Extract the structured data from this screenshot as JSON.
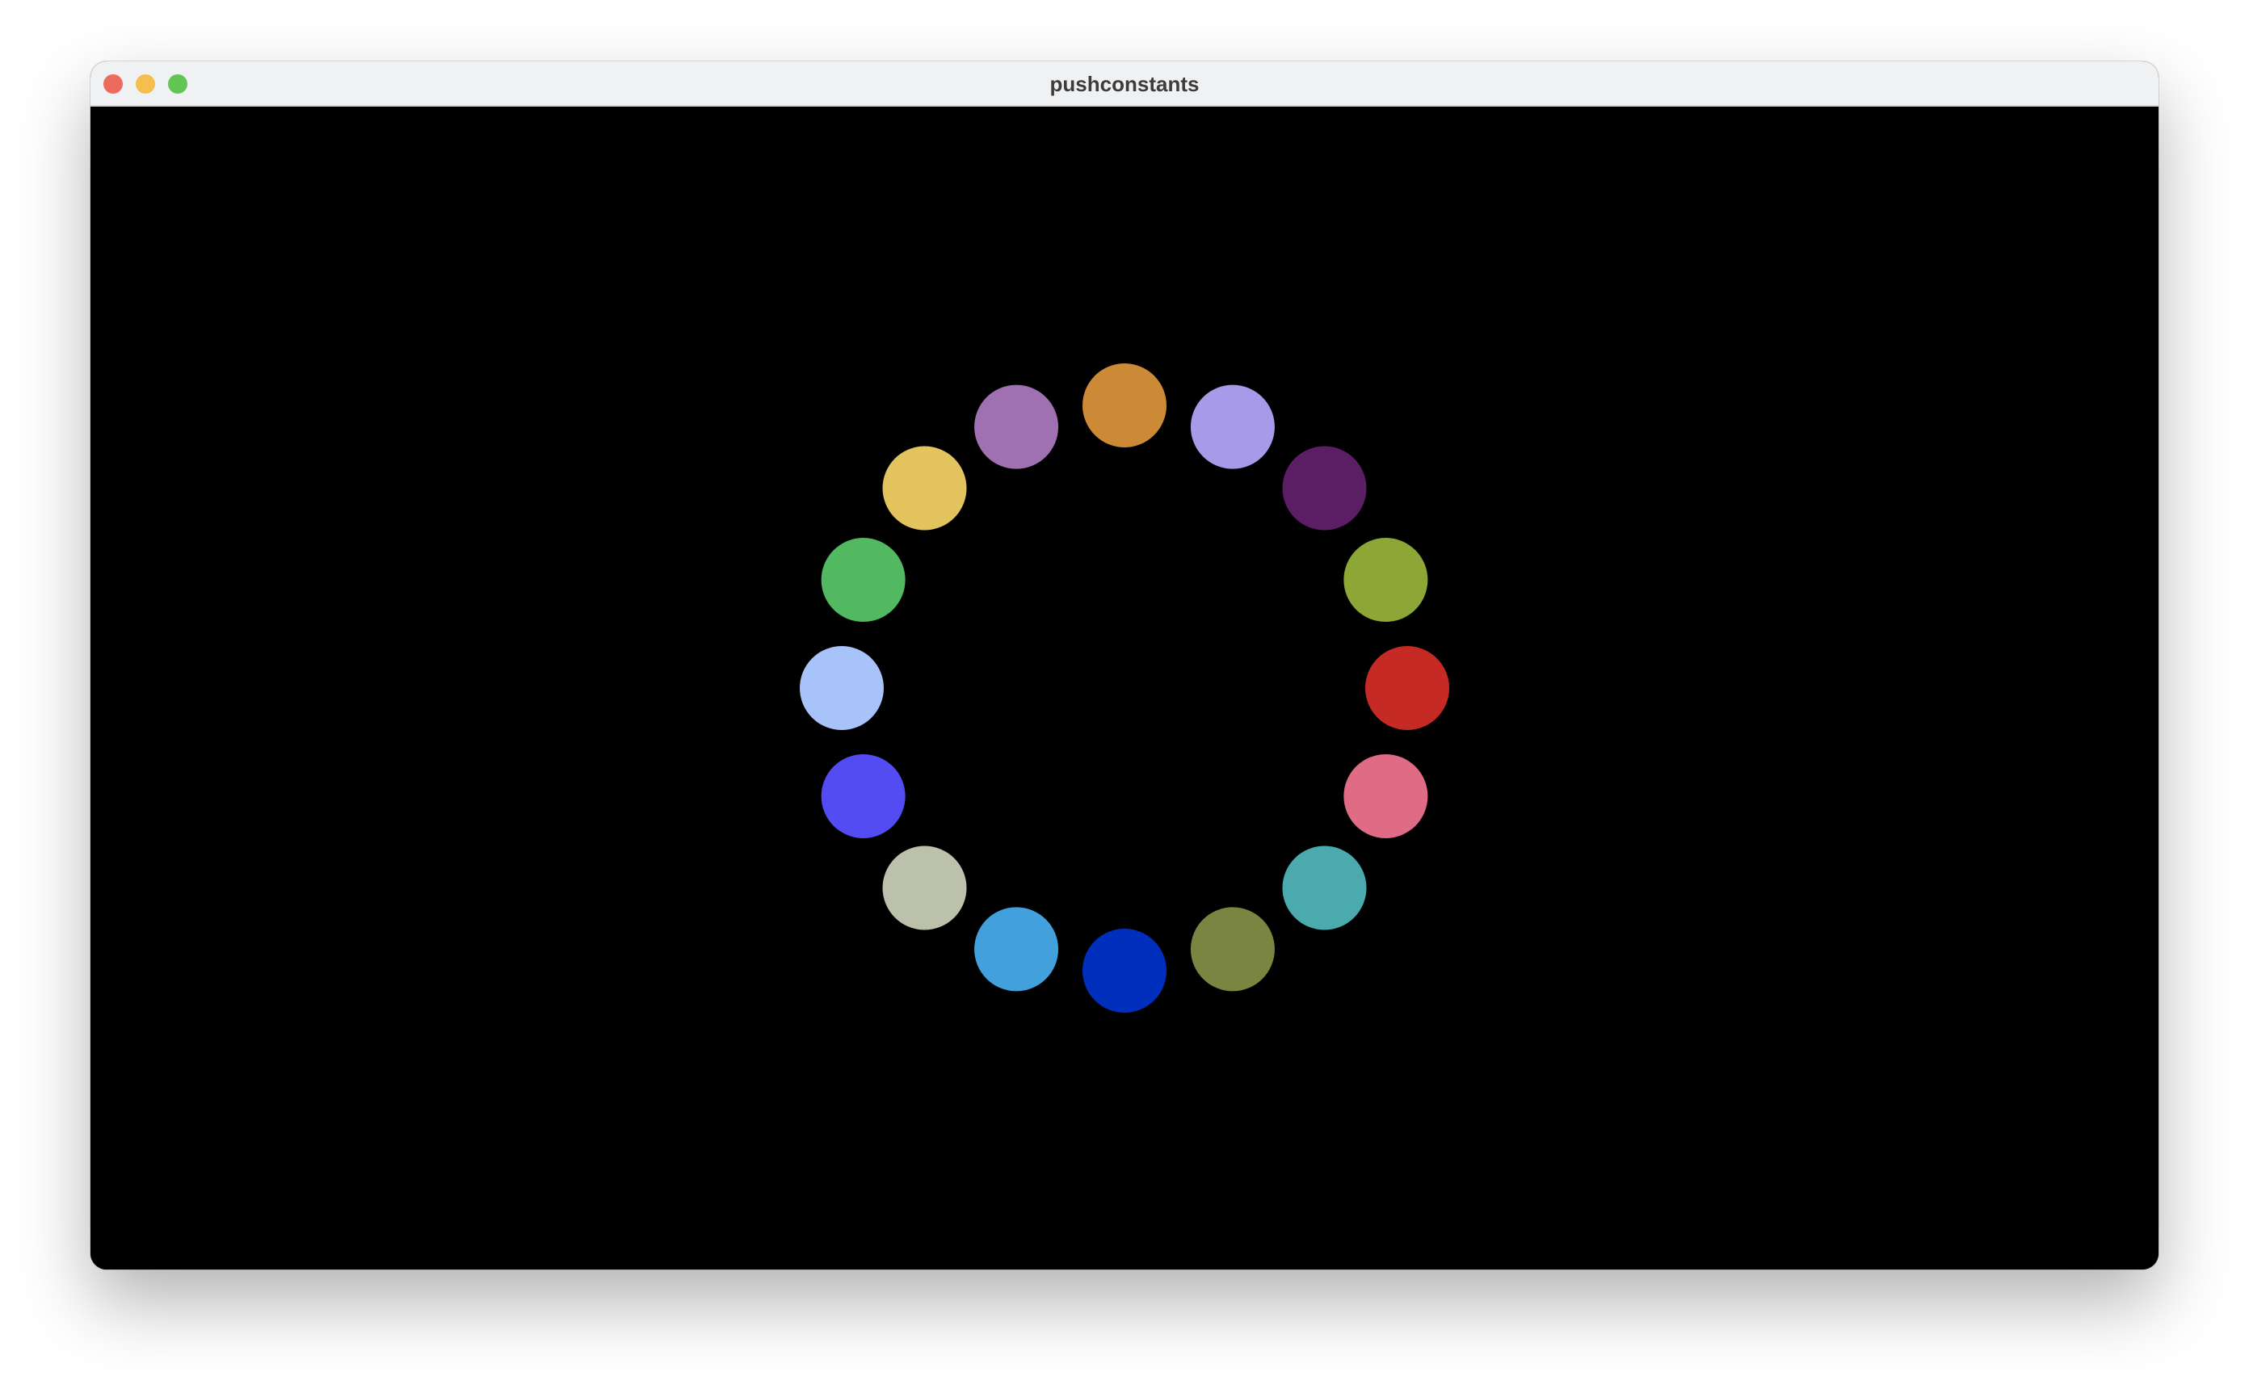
{
  "window": {
    "title": "pushconstants",
    "controls": {
      "close_color": "#ed6a5e",
      "minimize_color": "#f5bf4f",
      "zoom_color": "#61c554"
    }
  },
  "scene": {
    "background": "#000000",
    "ring": {
      "count": 16,
      "start_angle_deg": 0,
      "direction": "clockwise-from-right",
      "colors": [
        "#c52a24",
        "#e06b85",
        "#4aaaae",
        "#7a8541",
        "#002fbd",
        "#42a0dc",
        "#bbc1ab",
        "#534cf3",
        "#a8c2fa",
        "#52b960",
        "#e3c35e",
        "#9f71b1",
        "#cc8936",
        "#a79ae8",
        "#5b1e64",
        "#8ca735"
      ]
    }
  }
}
